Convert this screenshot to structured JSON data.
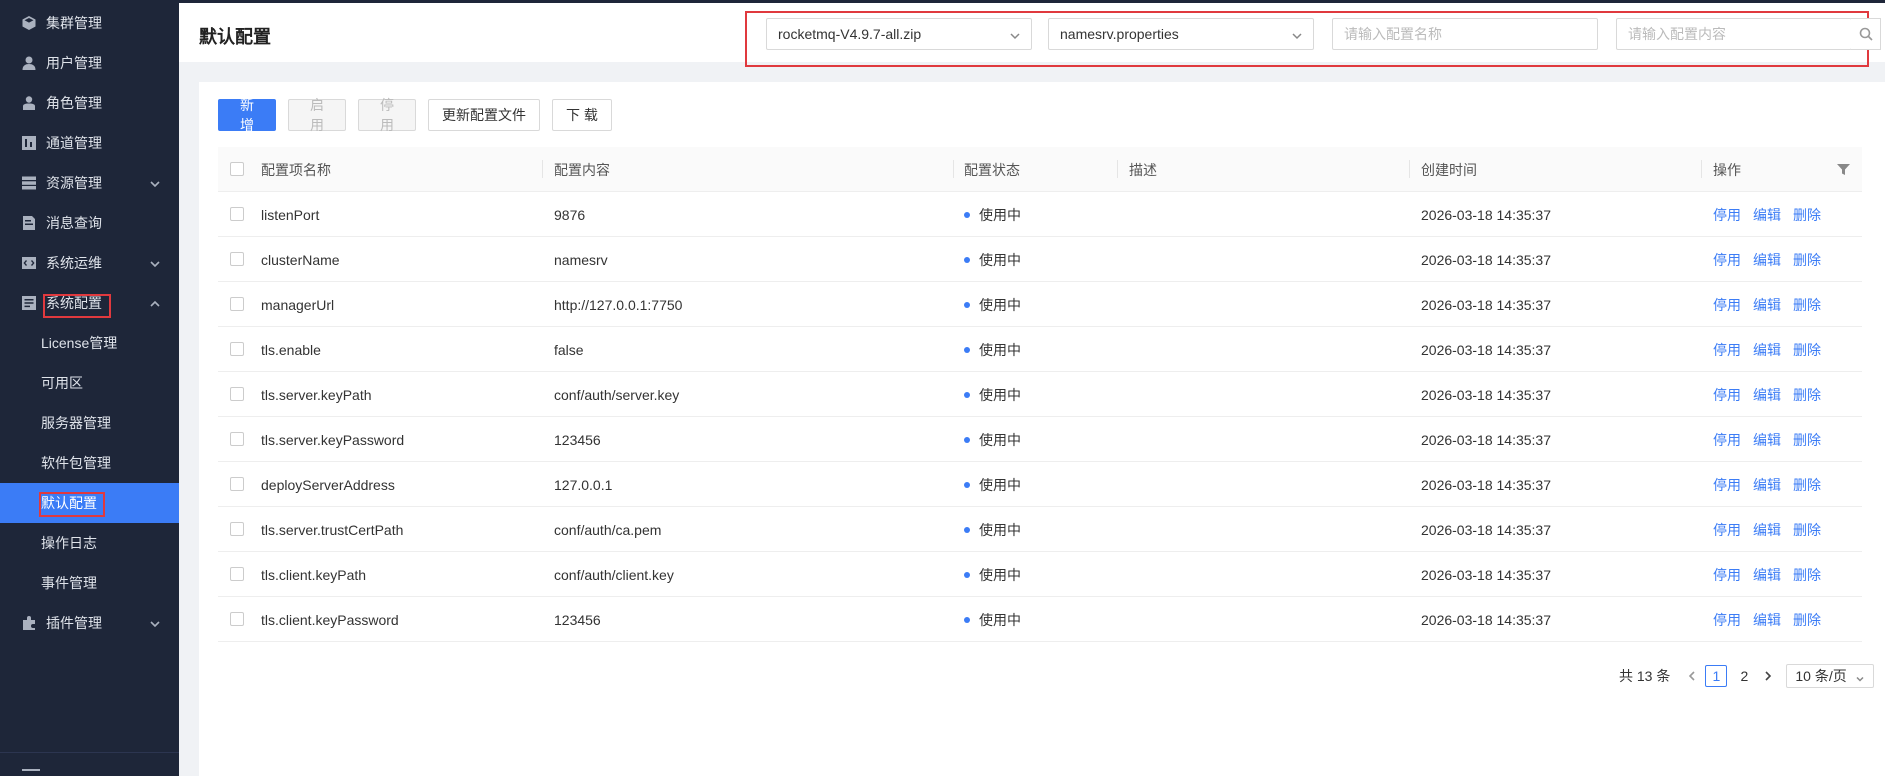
{
  "sidebar": {
    "items": [
      {
        "label": "集群管理",
        "icon": "cube-icon"
      },
      {
        "label": "用户管理",
        "icon": "user-icon"
      },
      {
        "label": "角色管理",
        "icon": "role-icon"
      },
      {
        "label": "通道管理",
        "icon": "channel-icon"
      },
      {
        "label": "资源管理",
        "icon": "server-icon",
        "expandable": true
      },
      {
        "label": "消息查询",
        "icon": "document-search-icon"
      },
      {
        "label": "系统运维",
        "icon": "code-icon",
        "expandable": true
      },
      {
        "label": "系统配置",
        "icon": "settings-panel-icon",
        "expanded": true
      }
    ],
    "sub_items": [
      {
        "label": "License管理"
      },
      {
        "label": "可用区"
      },
      {
        "label": "服务器管理"
      },
      {
        "label": "软件包管理"
      },
      {
        "label": "默认配置",
        "active": true
      },
      {
        "label": "操作日志"
      },
      {
        "label": "事件管理"
      }
    ],
    "plugin_item": {
      "label": "插件管理",
      "icon": "plugin-icon"
    }
  },
  "header": {
    "title": "默认配置",
    "package_select": "rocketmq-V4.9.7-all.zip",
    "file_select": "namesrv.properties",
    "name_placeholder": "请输入配置名称",
    "content_placeholder": "请输入配置内容"
  },
  "toolbar": {
    "add_label": "新 增",
    "enable_label": "启 用",
    "disable_label": "停 用",
    "update_label": "更新配置文件",
    "download_label": "下 载"
  },
  "table": {
    "columns": {
      "name": "配置项名称",
      "content": "配置内容",
      "status": "配置状态",
      "desc": "描述",
      "created": "创建时间",
      "ops": "操作"
    },
    "actions": {
      "disable": "停用",
      "edit": "编辑",
      "delete": "删除"
    },
    "rows": [
      {
        "name": "listenPort",
        "content": "9876",
        "status": "使用中",
        "desc": "",
        "created": "2026-03-18 14:35:37"
      },
      {
        "name": "clusterName",
        "content": "namesrv",
        "status": "使用中",
        "desc": "",
        "created": "2026-03-18 14:35:37"
      },
      {
        "name": "managerUrl",
        "content": "http://127.0.0.1:7750",
        "status": "使用中",
        "desc": "",
        "created": "2026-03-18 14:35:37"
      },
      {
        "name": "tls.enable",
        "content": "false",
        "status": "使用中",
        "desc": "",
        "created": "2026-03-18 14:35:37"
      },
      {
        "name": "tls.server.keyPath",
        "content": "conf/auth/server.key",
        "status": "使用中",
        "desc": "",
        "created": "2026-03-18 14:35:37"
      },
      {
        "name": "tls.server.keyPassword",
        "content": "123456",
        "status": "使用中",
        "desc": "",
        "created": "2026-03-18 14:35:37"
      },
      {
        "name": "deployServerAddress",
        "content": "127.0.0.1",
        "status": "使用中",
        "desc": "",
        "created": "2026-03-18 14:35:37"
      },
      {
        "name": "tls.server.trustCertPath",
        "content": "conf/auth/ca.pem",
        "status": "使用中",
        "desc": "",
        "created": "2026-03-18 14:35:37"
      },
      {
        "name": "tls.client.keyPath",
        "content": "conf/auth/client.key",
        "status": "使用中",
        "desc": "",
        "created": "2026-03-18 14:35:37"
      },
      {
        "name": "tls.client.keyPassword",
        "content": "123456",
        "status": "使用中",
        "desc": "",
        "created": "2026-03-18 14:35:37"
      }
    ]
  },
  "pagination": {
    "total": "共 13 条",
    "pages": [
      "1",
      "2"
    ],
    "current": "1",
    "page_size": "10 条/页"
  },
  "colors": {
    "accent": "#3b7cf6",
    "sidebar_bg": "#1e2639",
    "highlight_border": "#e0393e"
  }
}
